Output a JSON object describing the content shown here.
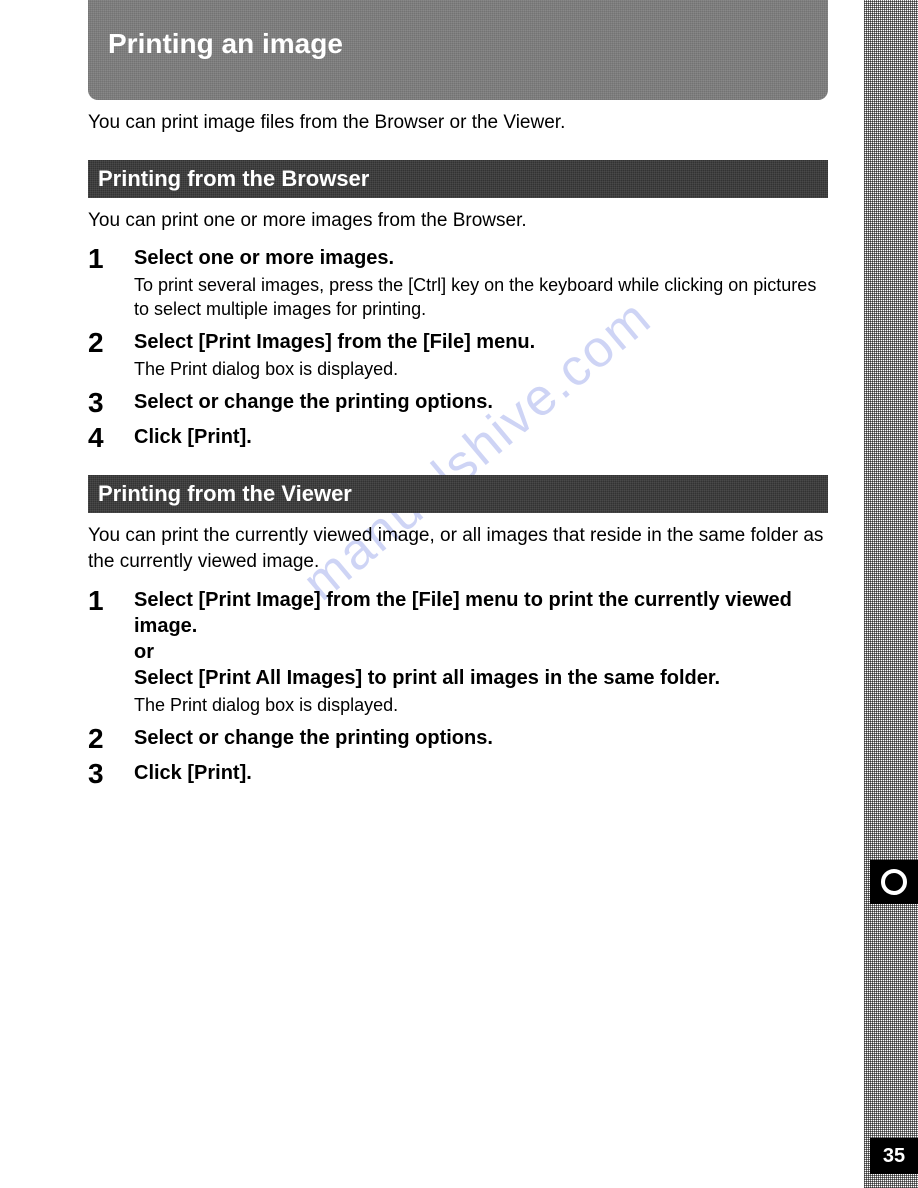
{
  "mainTitle": "Printing an image",
  "intro": "You can print image files from the Browser or the Viewer.",
  "watermark": "manualshive.com",
  "pageNumber": "35",
  "sections": [
    {
      "header": "Printing from the Browser",
      "intro": "You can print one or more images from the Browser.",
      "steps": [
        {
          "num": "1",
          "title": "Select one or more images.",
          "desc": "To print several images, press the [Ctrl] key on the keyboard while clicking on pictures to select multiple images for printing."
        },
        {
          "num": "2",
          "title": "Select [Print Images] from the [File] menu.",
          "desc": "The Print dialog box is displayed."
        },
        {
          "num": "3",
          "title": "Select or change the printing options.",
          "desc": ""
        },
        {
          "num": "4",
          "title": "Click [Print].",
          "desc": ""
        }
      ]
    },
    {
      "header": "Printing from the Viewer",
      "intro": "You can print the currently viewed image, or all images that reside in the same folder as the currently viewed image.",
      "steps": [
        {
          "num": "1",
          "title": "Select [Print Image] from the [File] menu to print the currently viewed image.\nor\nSelect [Print All Images] to print all images in the same folder.",
          "desc": "The Print dialog box is displayed."
        },
        {
          "num": "2",
          "title": "Select or change the printing options.",
          "desc": ""
        },
        {
          "num": "3",
          "title": "Click [Print].",
          "desc": ""
        }
      ]
    }
  ]
}
